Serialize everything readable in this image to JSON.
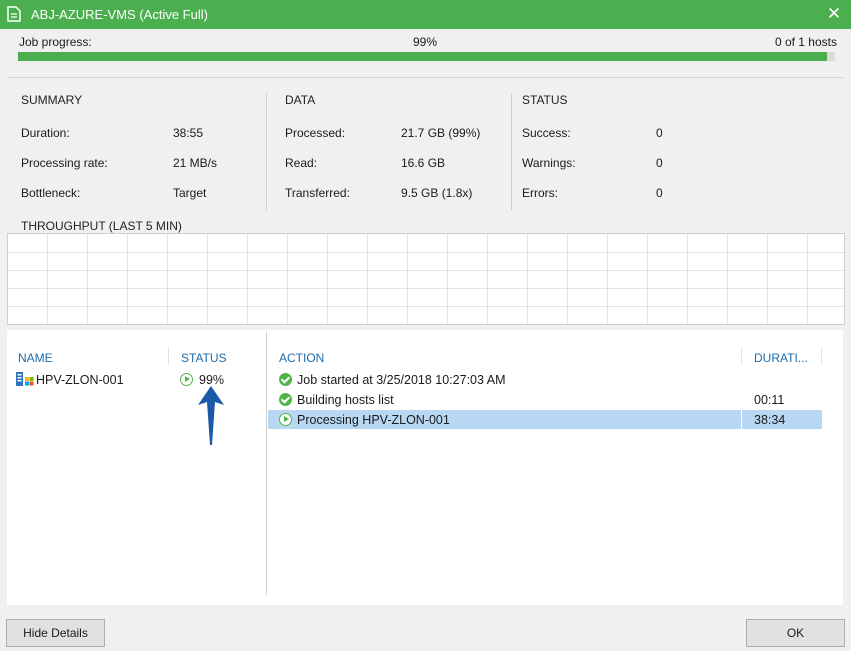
{
  "window": {
    "title": "ABJ-AZURE-VMS (Active Full)",
    "close_glyph": "✕"
  },
  "progress": {
    "label": "Job progress:",
    "percent_text": "99%",
    "percent": 99,
    "hosts_text": "0 of 1 hosts"
  },
  "summary": {
    "heading": "SUMMARY",
    "duration_label": "Duration:",
    "duration_value": "38:55",
    "rate_label": "Processing rate:",
    "rate_value": "21 MB/s",
    "bottleneck_label": "Bottleneck:",
    "bottleneck_value": "Target"
  },
  "data": {
    "heading": "DATA",
    "processed_label": "Processed:",
    "processed_value": "21.7 GB (99%)",
    "read_label": "Read:",
    "read_value": "16.6 GB",
    "transferred_label": "Transferred:",
    "transferred_value": "9.5 GB (1.8x)"
  },
  "status": {
    "heading": "STATUS",
    "success_label": "Success:",
    "success_value": "0",
    "warnings_label": "Warnings:",
    "warnings_value": "0",
    "errors_label": "Errors:",
    "errors_value": "0"
  },
  "throughput": {
    "heading": "THROUGHPUT (LAST 5 MIN)"
  },
  "vm_list": {
    "col_name": "NAME",
    "col_status": "STATUS",
    "rows": [
      {
        "name": "HPV-ZLON-001",
        "status": "99%"
      }
    ]
  },
  "actions": {
    "col_action": "ACTION",
    "col_duration": "DURATI...",
    "rows": [
      {
        "icon": "success-check-icon",
        "text": "Job started at 3/25/2018 10:27:03 AM",
        "duration": ""
      },
      {
        "icon": "success-check-icon",
        "text": "Building hosts list",
        "duration": "00:11"
      },
      {
        "icon": "running-play-icon",
        "text": "Processing HPV-ZLON-001",
        "duration": "38:34"
      }
    ]
  },
  "buttons": {
    "hide_details": "Hide Details",
    "ok": "OK"
  },
  "colors": {
    "accent_green": "#4caf4f",
    "header_blue": "#1e6ba8",
    "selection": "#b7d7f3",
    "annotation_arrow": "#1a5aa8"
  }
}
